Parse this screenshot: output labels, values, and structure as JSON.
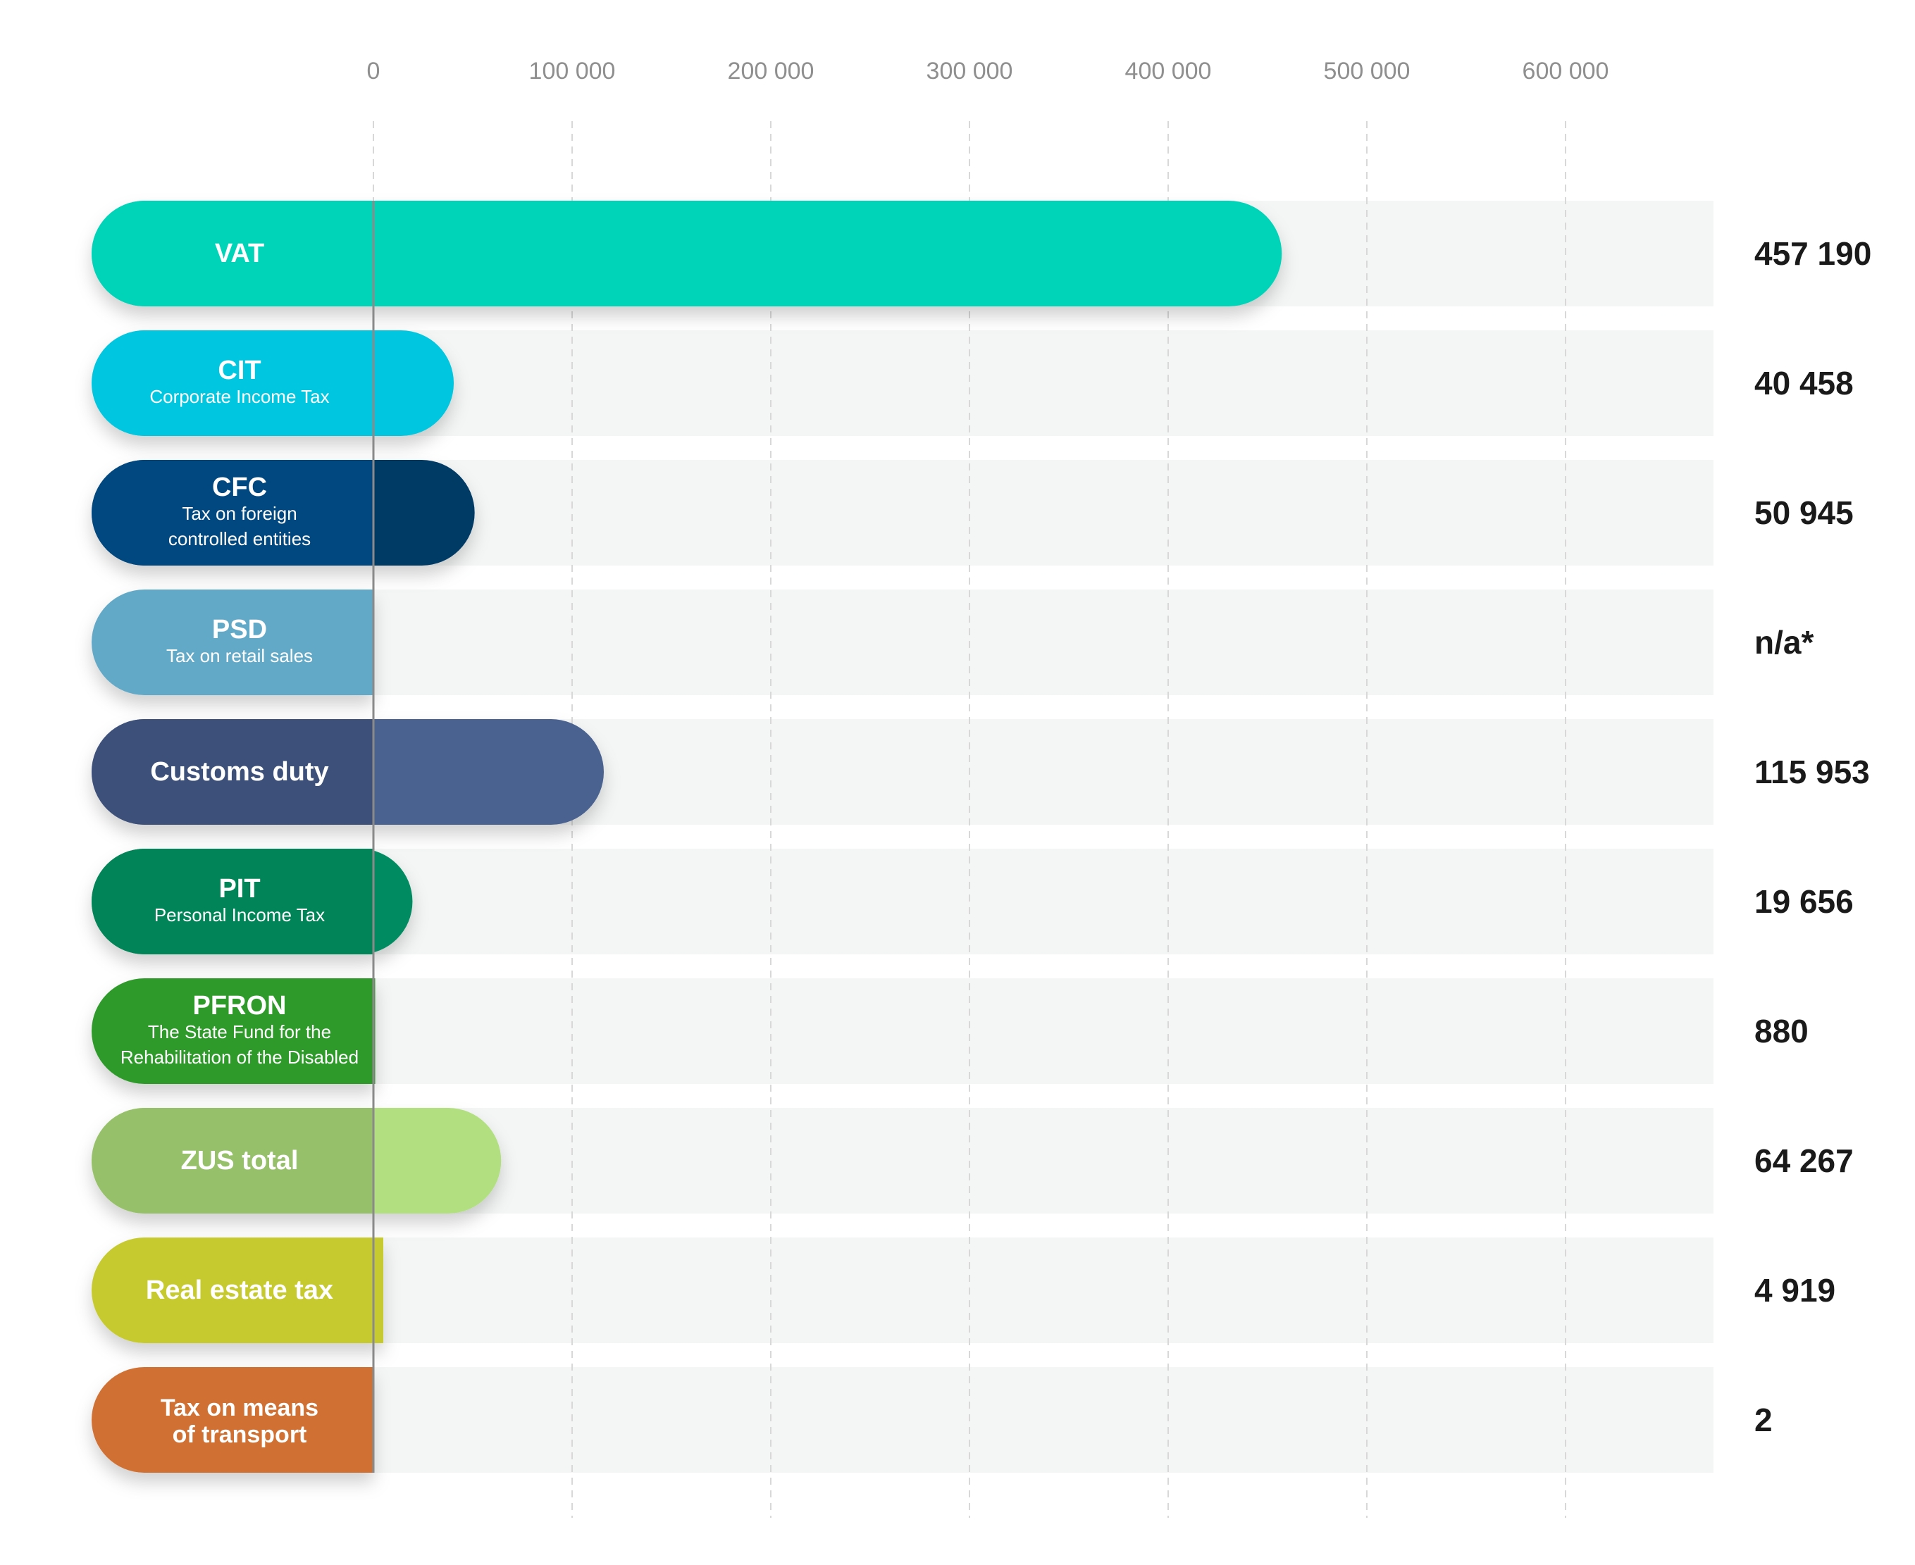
{
  "chart_data": {
    "type": "bar",
    "orientation": "horizontal",
    "title": "",
    "xlabel": "",
    "ylabel": "",
    "xlim": [
      0,
      600000
    ],
    "ticks": [
      0,
      100000,
      200000,
      300000,
      400000,
      500000,
      600000
    ],
    "tick_labels": [
      "0",
      "100 000",
      "200 000",
      "300 000",
      "400 000",
      "500 000",
      "600 000"
    ],
    "grid": "vertical dashed",
    "categories": [
      {
        "label": "VAT",
        "sublabel": "",
        "value": 457190,
        "value_label": "457 190",
        "color": "#00d4b8"
      },
      {
        "label": "CIT",
        "sublabel": "Corporate Income Tax",
        "value": 40458,
        "value_label": "40 458",
        "color": "#00c7df"
      },
      {
        "label": "CFC",
        "sublabel": "Tax on foreign controlled entities",
        "sublabel_lines": [
          "Tax on foreign",
          "controlled entities"
        ],
        "value": 50945,
        "value_label": "50 945",
        "color": "#00487f",
        "bar_color": "#003a66"
      },
      {
        "label": "PSD",
        "sublabel": "Tax on retail sales",
        "value": null,
        "value_label": "n/a*",
        "color": "#62a9c8"
      },
      {
        "label": "Customs duty",
        "sublabel": "",
        "value": 115953,
        "value_label": "115 953",
        "color": "#3d5079",
        "bar_color": "#4a6290"
      },
      {
        "label": "PIT",
        "sublabel": "Personal Income Tax",
        "value": 19656,
        "value_label": "19 656",
        "color": "#008458",
        "bar_color": "#058b61"
      },
      {
        "label": "PFRON",
        "sublabel": "The State Fund for the Rehabilitation of the Disabled",
        "sublabel_lines": [
          "The State Fund for the",
          "Rehabilitation of the Disabled"
        ],
        "value": 880,
        "value_label": "880",
        "color": "#2e9a2b"
      },
      {
        "label": "ZUS total",
        "sublabel": "",
        "value": 64267,
        "value_label": "64 267",
        "color": "#97c06a",
        "bar_color": "#b2df80"
      },
      {
        "label": "Real estate tax",
        "sublabel": "",
        "value": 4919,
        "value_label": "4 919",
        "color": "#c6ca2e"
      },
      {
        "label": "Tax on means of transport",
        "sublabel": "",
        "label_lines": [
          "Tax on means",
          "of transport"
        ],
        "value": 2,
        "value_label": "2",
        "color": "#d06f32"
      }
    ],
    "colors": {
      "track": "#f4f6f6",
      "grid": "#d8d8d8",
      "axis": "#8a8a8a",
      "tick_text": "#8f8f8f",
      "value_text": "#1a1a1a"
    }
  }
}
